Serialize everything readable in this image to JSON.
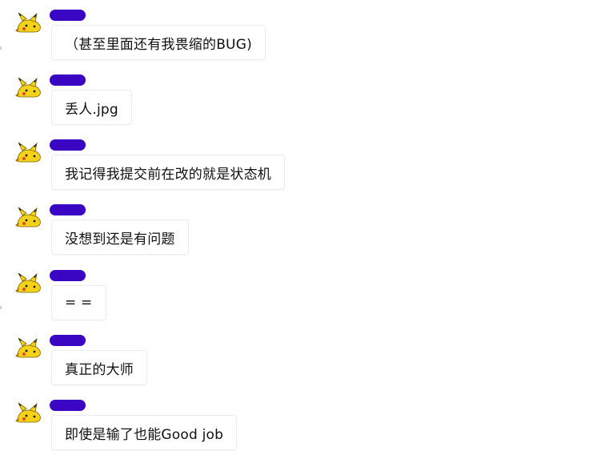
{
  "messages": [
    {
      "text": "（甚至里面还有我畏缩的BUG)"
    },
    {
      "text": "丢人.jpg"
    },
    {
      "text": "我记得我提交前在改的就是状态机"
    },
    {
      "text": "没想到还是有问题"
    },
    {
      "text": "= ="
    },
    {
      "text": "真正的大师"
    },
    {
      "text": "即使是输了也能Good job"
    }
  ],
  "colors": {
    "name_pill": "#3a06c4",
    "avatar_yellow": "#f5d21a",
    "bubble_border": "#ececec"
  },
  "icons": {
    "avatar": "pikachu-sticker-icon"
  }
}
